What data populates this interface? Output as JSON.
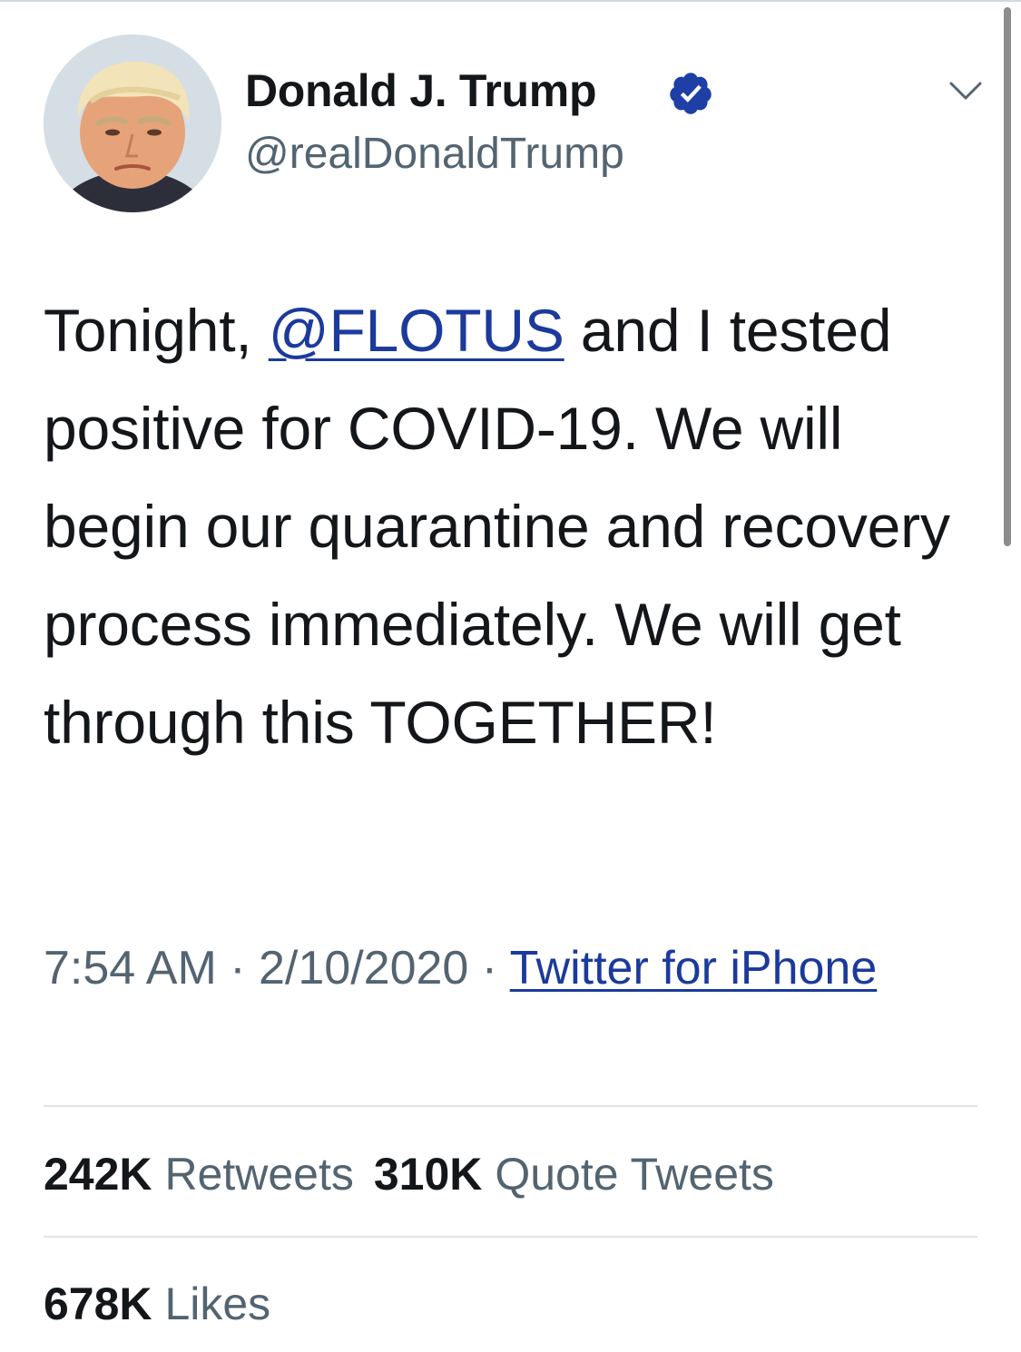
{
  "author": {
    "display_name": "Donald J. Trump",
    "handle": "@realDonaldTrump",
    "verified": true,
    "avatar": "profile-photo"
  },
  "menu_icon": "chevron-down-icon",
  "tweet": {
    "text_before": "Tonight, ",
    "mention": "@FLOTUS",
    "text_after": " and I tested positive for COVID-19. We will begin our quarantine and recovery process immediately. We will get through this TOGETHER!"
  },
  "meta": {
    "time": "7:54 AM",
    "separator_1": " · ",
    "date": "2/10/2020",
    "separator_2": " · ",
    "source": "Twitter for iPhone"
  },
  "stats": {
    "retweets": {
      "count": "242K",
      "label": "Retweets"
    },
    "quote_tweets": {
      "count": "310K",
      "label": "Quote Tweets"
    },
    "likes": {
      "count": "678K",
      "label": "Likes"
    }
  },
  "colors": {
    "link": "#1b3a9c",
    "verified": "#1d3fa6",
    "text": "#14171a",
    "secondary": "#536471"
  }
}
